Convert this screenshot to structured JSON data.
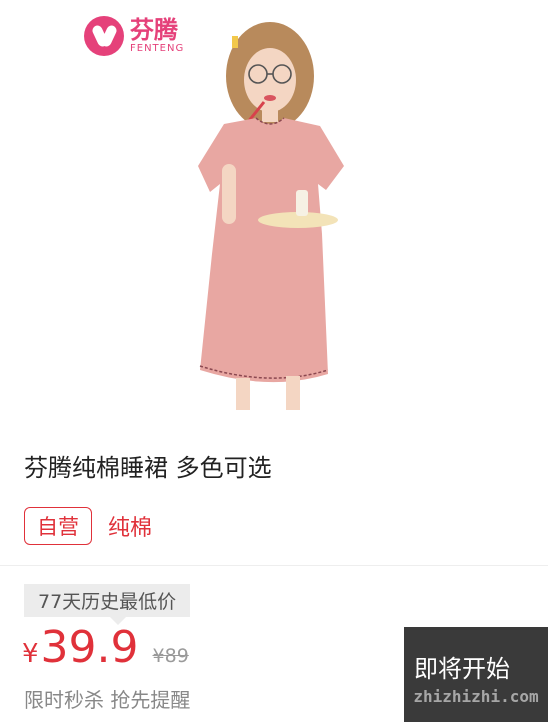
{
  "brand": {
    "name_cn": "芬腾",
    "name_en": "FENTENG",
    "color": "#e5417a"
  },
  "product": {
    "title": "芬腾纯棉睡裙 多色可选",
    "tag_self": "自营",
    "tag_cotton": "纯棉",
    "dress_color": "#e8a7a2"
  },
  "pricing": {
    "history_badge": "77天历史最低价",
    "currency": "¥",
    "price": "39.9",
    "original_price": "¥89",
    "flash_text": "限时秒杀 抢先提醒",
    "accent": "#e0313a"
  },
  "countdown": {
    "label": "即将开始",
    "watermark": "zhizhizhi.com"
  }
}
